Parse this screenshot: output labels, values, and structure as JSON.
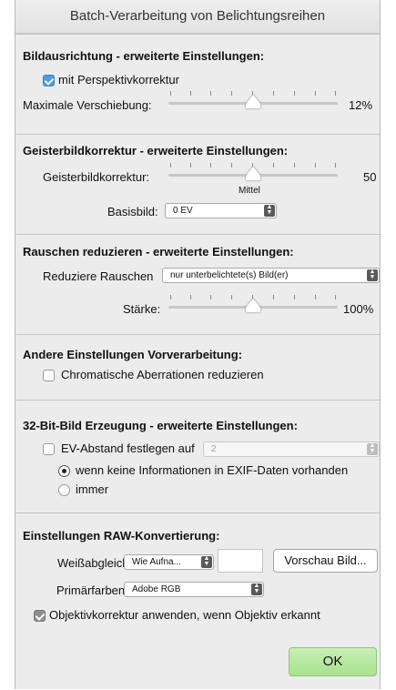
{
  "window": {
    "title": "Batch-Verarbeitung von Belichtungsreihen"
  },
  "alignment": {
    "heading": "Bildausrichtung - erweiterte Einstellungen:",
    "perspective_label": "mit Perspektivkorrektur",
    "perspective_checked": true,
    "shift_label": "Maximale Verschiebung:",
    "shift_value": "12%",
    "shift_level": 0.5
  },
  "ghost": {
    "heading": "Geisterbildkorrektur - erweiterte Einstellungen:",
    "ghost_label": "Geisterbildkorrektur:",
    "ghost_value": "50",
    "ghost_level": 0.5,
    "ghost_caption": "Mittel",
    "base_label": "Basisbild:",
    "base_value": "0 EV"
  },
  "noise": {
    "heading": "Rauschen reduzieren - erweiterte Einstellungen:",
    "reduce_label": "Reduziere Rauschen",
    "reduce_value": "nur unterbelichtete(s) Bild(er)",
    "strength_label": "Stärke:",
    "strength_value": "100%",
    "strength_level": 0.5
  },
  "other": {
    "heading": "Andere Einstellungen Vorverarbeitung:",
    "chromatic_label": "Chromatische Aberrationen reduzieren",
    "chromatic_checked": false
  },
  "bit32": {
    "heading": "32-Bit-Bild Erzeugung - erweiterte Einstellungen:",
    "ev_label": "EV-Abstand festlegen auf",
    "ev_value": "2",
    "radio_exif_label": "wenn keine Informationen in EXIF-Daten vorhanden",
    "radio_always_label": "immer"
  },
  "raw": {
    "heading": "Einstellungen RAW-Konvertierung:",
    "wb_label": "Weißabgleich",
    "wb_value": "Wie Aufna...",
    "preview_button": "Vorschau Bild...",
    "primaries_label": "Primärfarben",
    "primaries_value": "Adobe RGB",
    "lens_label": "Objektivkorrektur anwenden, wenn Objektiv erkannt",
    "lens_checked": true
  },
  "footer": {
    "ok_label": "OK"
  },
  "colors": {
    "ok_green": "#b6e8a0",
    "checkbox_blue": "#4a9be8"
  }
}
